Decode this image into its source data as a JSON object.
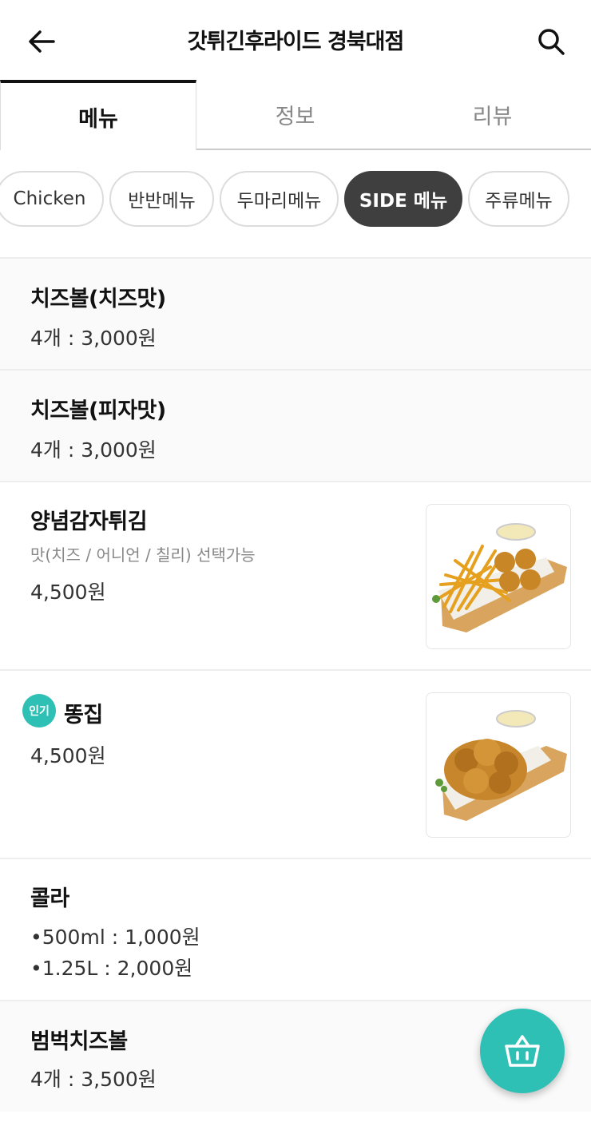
{
  "header": {
    "title": "갓튀긴후라이드 경북대점",
    "back_icon": "arrow-left-icon",
    "search_icon": "search-icon"
  },
  "tabs": [
    {
      "label": "메뉴",
      "active": true
    },
    {
      "label": "정보",
      "active": false
    },
    {
      "label": "리뷰",
      "active": false
    }
  ],
  "categories": [
    {
      "label": "Chicken",
      "active": false
    },
    {
      "label": "반반메뉴",
      "active": false
    },
    {
      "label": "두마리메뉴",
      "active": false
    },
    {
      "label": "SIDE 메뉴",
      "active": true
    },
    {
      "label": "주류메뉴",
      "active": false
    }
  ],
  "menu": {
    "items": [
      {
        "name": "치즈볼(치즈맛)",
        "price": "4개 : 3,000원"
      },
      {
        "name": "치즈볼(피자맛)",
        "price": "4개 : 3,000원"
      },
      {
        "name": "양념감자튀김",
        "desc": "맛(치즈 / 어니언 / 칠리) 선택가능",
        "price": "4,500원",
        "image": "fries-cheeseball-photo"
      },
      {
        "name": "똥집",
        "badge": "인기",
        "price": "4,500원",
        "image": "fried-gizzard-photo"
      },
      {
        "name": "콜라",
        "prices": [
          "•500ml : 1,000원",
          "•1.25L : 2,000원"
        ]
      },
      {
        "name": "범벅치즈볼",
        "price": "4개 : 3,500원"
      }
    ]
  },
  "cart": {
    "icon": "basket-icon"
  },
  "colors": {
    "accent": "#2ebfb5",
    "active_chip": "#3f3f3f"
  }
}
